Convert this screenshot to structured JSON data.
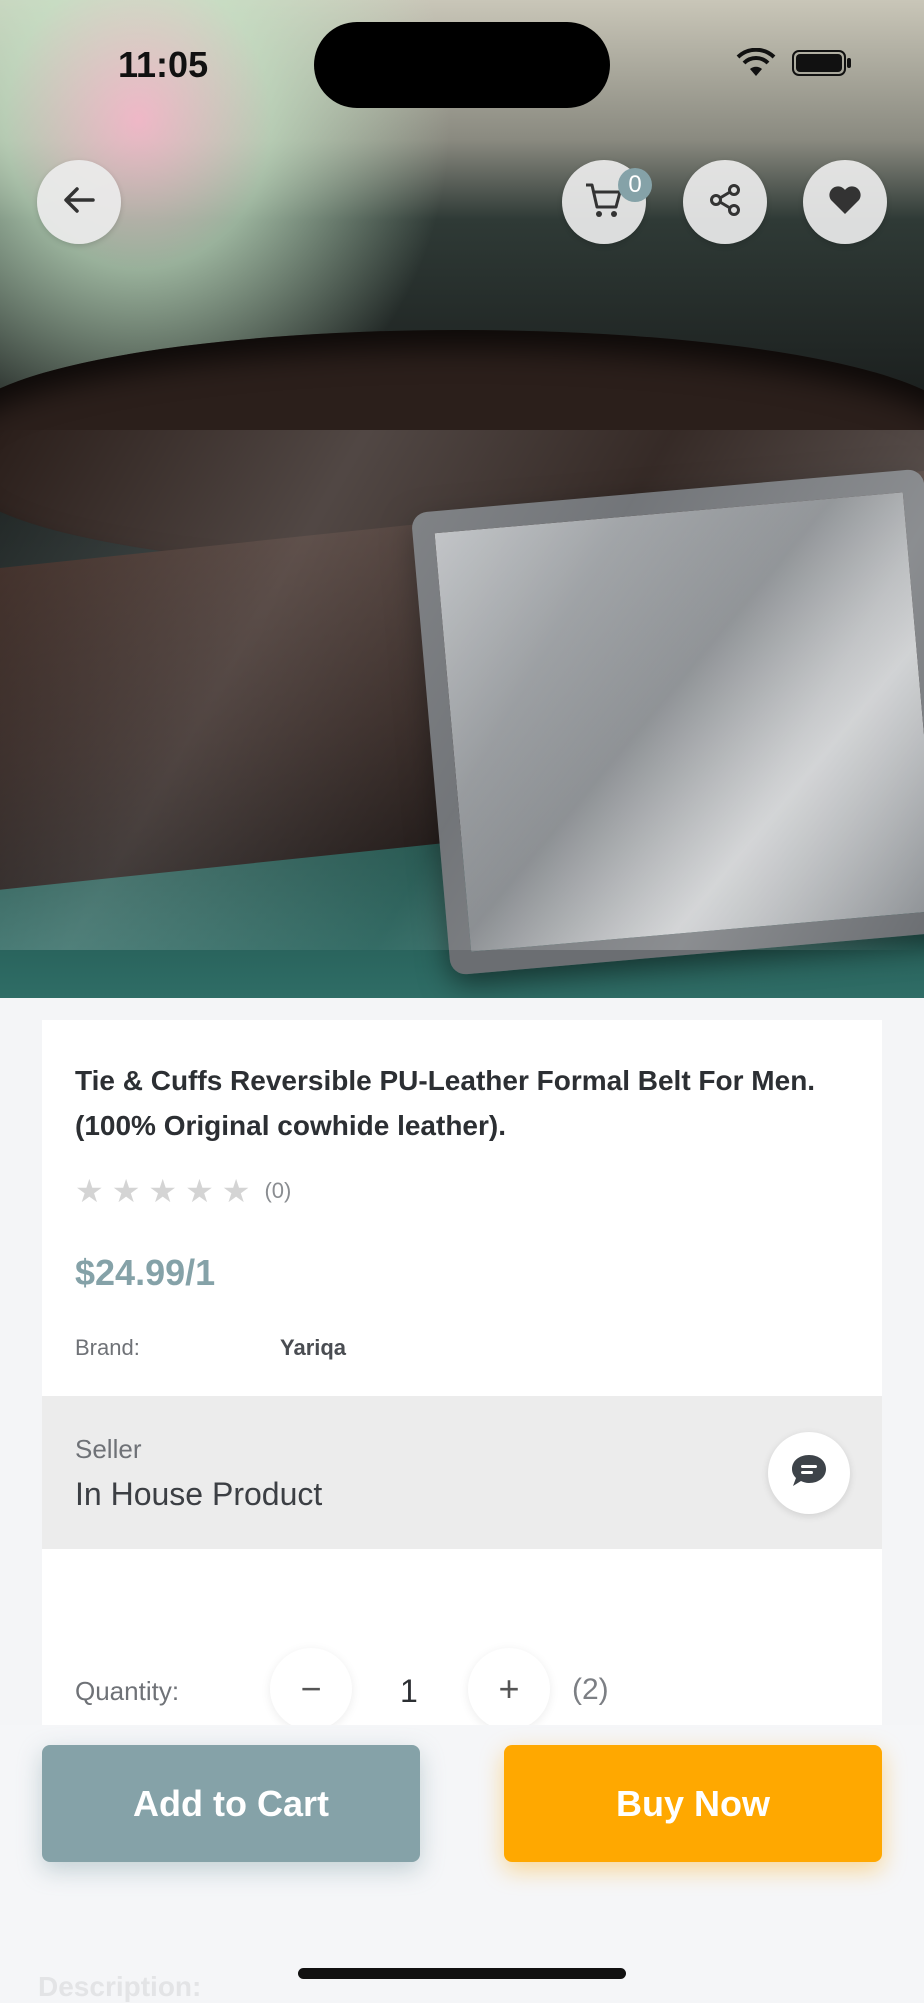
{
  "status_bar": {
    "time": "11:05"
  },
  "header": {
    "back_icon": "arrow-left-icon",
    "cart_icon": "cart-icon",
    "cart_count": "0",
    "share_icon": "share-icon",
    "wishlist_icon": "heart-icon"
  },
  "product": {
    "title": "Tie & Cuffs Reversible PU-Leather Formal Belt For Men. (100% Original cowhide leather).",
    "rating": 0,
    "rating_count": "(0)",
    "price": "$24.99/1",
    "brand_label": "Brand:",
    "brand_value": "Yariqa"
  },
  "seller": {
    "label": "Seller",
    "name": "In House Product",
    "chat_icon": "chat-bubble-icon"
  },
  "quantity": {
    "label": "Quantity:",
    "decrement": "−",
    "value": "1",
    "increment": "+",
    "stock": "(2)"
  },
  "actions": {
    "add_to_cart": "Add to Cart",
    "buy_now": "Buy Now"
  },
  "description_label": "Description:",
  "colors": {
    "accent": "#85a2a8",
    "buy": "#ffa800"
  }
}
